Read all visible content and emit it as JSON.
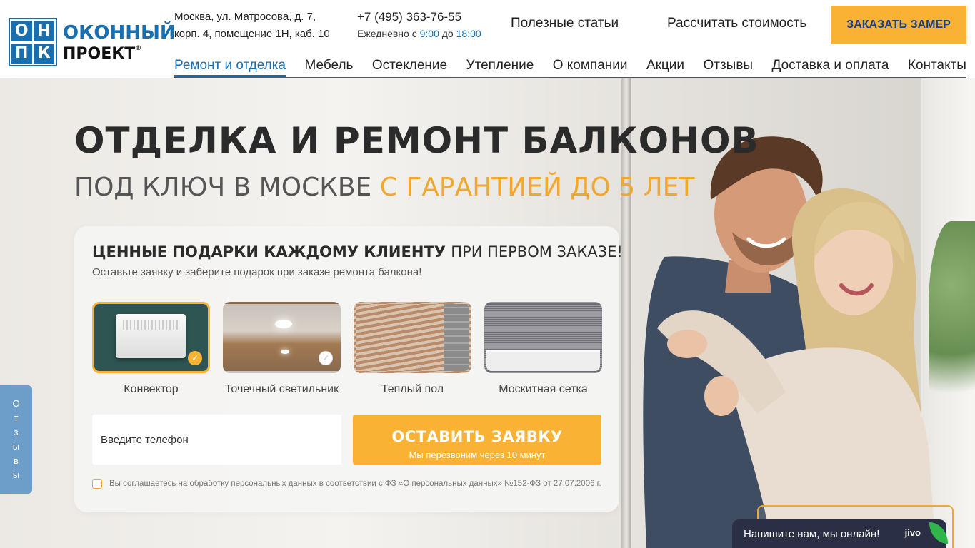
{
  "header": {
    "logo": {
      "cells": [
        "О",
        "Н",
        "П",
        "К"
      ],
      "line1": "ОКОННЫЙ",
      "line2": "ПРОЕКТ",
      "reg": "®"
    },
    "address_line1": "Москва, ул. Матросова, д. 7,",
    "address_line2": "корп. 4, помещение 1Н, каб. 10",
    "phone": "+7 (495) 363-76-55",
    "hours_prefix": "Ежедневно с",
    "hours_from": "9:00",
    "hours_mid": "до",
    "hours_to": "18:00",
    "link_articles": "Полезные статьи",
    "link_calc": "Рассчитать стоимость",
    "btn_measure": "ЗАКАЗАТЬ ЗАМЕР"
  },
  "nav": [
    {
      "label": "Ремонт и отделка",
      "active": true
    },
    {
      "label": "Мебель"
    },
    {
      "label": "Остекление"
    },
    {
      "label": "Утепление"
    },
    {
      "label": "О компании"
    },
    {
      "label": "Акции"
    },
    {
      "label": "Отзывы"
    },
    {
      "label": "Доставка и оплата"
    },
    {
      "label": "Контакты"
    }
  ],
  "hero": {
    "title": "ОТДЕЛКА И РЕМОНТ БАЛКОНОВ",
    "subtitle_main": "ПОД КЛЮЧ В МОСКВЕ",
    "subtitle_accent": "С ГАРАНТИЕЙ ДО 5 ЛЕТ"
  },
  "form": {
    "title_bold": "ЦЕННЫЕ ПОДАРКИ КАЖДОМУ КЛИЕНТУ",
    "title_thin": "ПРИ ПЕРВОМ ЗАКАЗЕ!",
    "subtitle": "Оставьте заявку и заберите подарок при заказе ремонта балкона!",
    "gifts": [
      {
        "label": "Конвектор",
        "selected": true
      },
      {
        "label": "Точечный светильник",
        "selected": false
      },
      {
        "label": "Теплый пол",
        "selected": false
      },
      {
        "label": "Москитная сетка",
        "selected": false
      }
    ],
    "check_glyph": "✓",
    "phone_placeholder": "Введите телефон",
    "submit_main": "ОСТАВИТЬ ЗАЯВКУ",
    "submit_sub": "Мы перезвоним через 10 минут",
    "consent": "Вы соглашаетесь на обработку персональных данных в соответствии с ФЗ «О персональных данных» №152-ФЗ от 27.07.2006 г."
  },
  "side_tab": [
    "О",
    "т",
    "з",
    "ы",
    "в",
    "ы"
  ],
  "chat": {
    "text": "Напишите нам, мы онлайн!",
    "brand": "jivo"
  },
  "colors": {
    "brand_blue": "#1a6fb0",
    "accent_orange": "#f9b233",
    "side_tab": "#6d9ec9",
    "chat_bg": "#2a2f45"
  }
}
